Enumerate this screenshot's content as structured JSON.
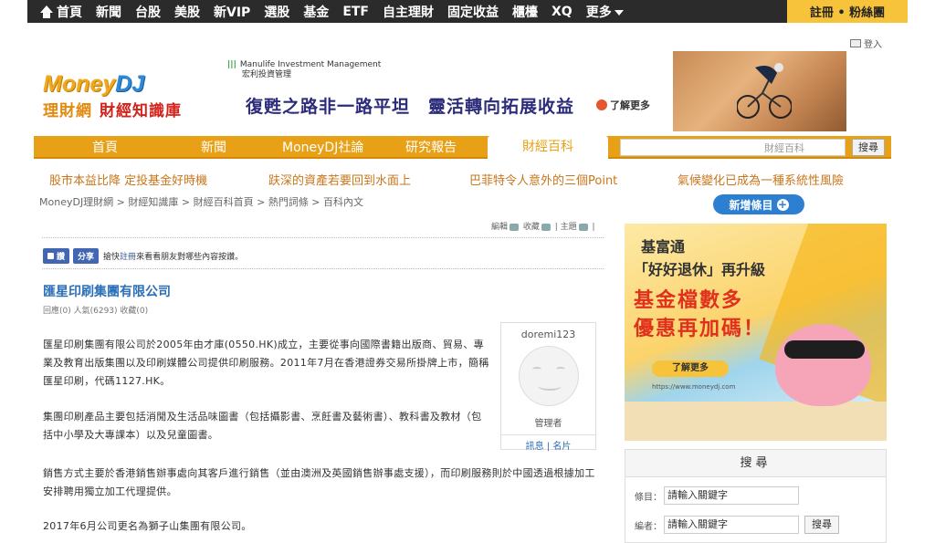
{
  "topnav": {
    "items": [
      "首頁",
      "新聞",
      "台股",
      "美股",
      "新VIP",
      "選股",
      "基金",
      "ETF",
      "自主理財",
      "固定收益",
      "櫃檯",
      "XQ",
      "更多"
    ],
    "register": "註冊 • 粉絲團"
  },
  "login": "登入",
  "logo": {
    "brand_main": "Money",
    "brand_dj": "DJ",
    "sub1": "理財網",
    "sub2": "財經知識庫"
  },
  "ad_banner": {
    "brand_line1": "Manulife Investment Management",
    "brand_line2": "宏利投資管理",
    "headline": "復甦之路非一路平坦　靈活轉向拓展收益",
    "more": "了解更多"
  },
  "mainnav": {
    "items": [
      "首頁",
      "新聞",
      "MoneyDJ社論",
      "研究報告",
      "財經百科"
    ],
    "active": "財經百科",
    "search_category": "財經百科",
    "search_button": "搜尋"
  },
  "hotlinks": [
    "股市本益比降 定投基金好時機",
    "趺深的資產若要回到水面上",
    "巴菲特令人意外的三個Point",
    "氣候變化已成為一種系統性風險"
  ],
  "breadcrumb": "MoneyDJ理財網 > 財經知識庫 > 財經百科首頁 > 熱門詞條 > 百科內文",
  "new_entry": "新增條目",
  "toolbar": {
    "edit": "編輯",
    "favorite": "收藏",
    "tag": "主題"
  },
  "like_row": {
    "like": "讚",
    "share": "分享",
    "prefix": "搶快",
    "register": "註冊",
    "suffix": "來看看朋友對哪些內容按讚。"
  },
  "article": {
    "title": "匯星印刷集團有限公司",
    "meta": "回應(0) 人氣(6293) 收藏(0)",
    "p1": "匯星印刷集團有限公司於2005年由才庫(0550.HK)成立，主要從事向國際書籍出版商、貿易、專業及教育出版集團以及印刷媒體公司提供印刷服務。2011年7月在香港證券交易所掛牌上市，簡稱匯星印刷，代碼1127.HK。",
    "p2": "集團印刷產品主要包括消閒及生活品味圖書（包括攝影書、烹飪書及藝術書）、教科書及教材（包括中小學及大專課本）以及兒童圖書。",
    "p3": "銷售方式主要於香港銷售辦事處向其客戶進行銷售（並由澳洲及英國銷售辦事處支援），而印刷服務則於中國透過根據加工安排聘用獨立加工代理提供。",
    "p4": "2017年6月公司更名為獅子山集團有限公司。"
  },
  "author": {
    "name": "doremi123",
    "role": "管理者",
    "links": "訊息 | 名片"
  },
  "side_ad": {
    "line1": "基富通",
    "line2": "「好好退休」再升級",
    "line3": "基金檔數多",
    "line4": "優惠再加碼！",
    "more": "了解更多",
    "url": "https://www.moneydj.com"
  },
  "search_panel": {
    "title": "搜尋",
    "entry_label": "條目：",
    "entry_value": "請輸入關鍵字",
    "author_label": "編者：",
    "author_value": "請輸入關鍵字",
    "button": "搜尋"
  }
}
